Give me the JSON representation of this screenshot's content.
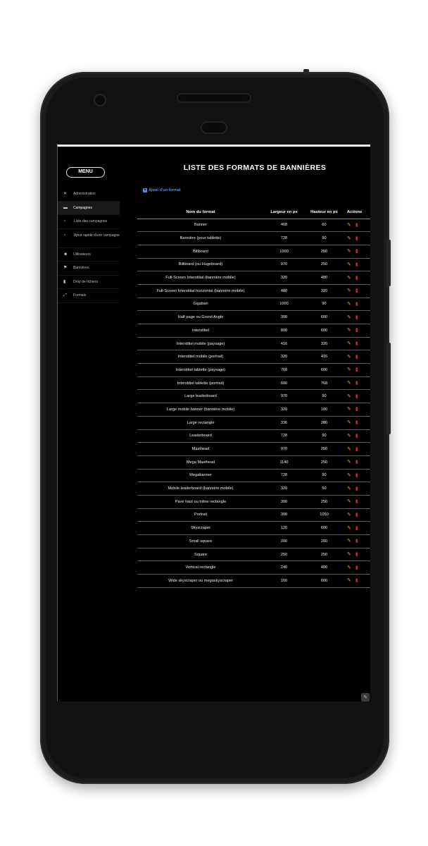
{
  "menu": {
    "label": "MENU"
  },
  "nav": [
    {
      "icon": "tools-icon",
      "glyph": "✕",
      "label": "Administration",
      "active": false,
      "sub": false
    },
    {
      "icon": "campaign-icon",
      "glyph": "▬",
      "label": "Campagnes",
      "active": true,
      "sub": false
    },
    {
      "icon": "chevron-right-icon",
      "glyph": "›",
      "label": "Liste des campagnes",
      "active": false,
      "sub": true
    },
    {
      "icon": "chevron-right-icon",
      "glyph": "›",
      "label": "Ajout rapide d'une campagne",
      "active": false,
      "sub": true
    },
    {
      "icon": "users-icon",
      "glyph": "☻",
      "label": "Utilisateurs",
      "active": false,
      "sub": false
    },
    {
      "icon": "flag-icon",
      "glyph": "⚑",
      "label": "Bannières",
      "active": false,
      "sub": false
    },
    {
      "icon": "file-icon",
      "glyph": "▮",
      "label": "Drop de fichiers",
      "active": false,
      "sub": false
    },
    {
      "icon": "resize-icon",
      "glyph": "⤢",
      "label": "Formats",
      "active": false,
      "sub": false
    }
  ],
  "page": {
    "title": "LISTE DES FORMATS DE BANNIÈRES",
    "add_label": "Ajout d'un format"
  },
  "table": {
    "headers": [
      "Nom du format",
      "Largeur en px",
      "Hauteur en px",
      "Actions"
    ],
    "rows": [
      [
        "Banner",
        "468",
        "60"
      ],
      [
        "Bannière (pour tablette)",
        "728",
        "90"
      ],
      [
        "Billboard",
        "1000",
        "250"
      ],
      [
        "Billboard (ou Hugeboard)",
        "970",
        "250"
      ],
      [
        "Full-Screen Interstitial (bannière mobile)",
        "320",
        "480"
      ],
      [
        "Full-Screen Interstitial horizontal (bannière mobile)",
        "480",
        "320"
      ],
      [
        "Gigaban",
        "1000",
        "90"
      ],
      [
        "Half-page ou Grand Angle",
        "300",
        "600"
      ],
      [
        "Interstitiel",
        "800",
        "600"
      ],
      [
        "Interstitiel mobile (paysage)",
        "416",
        "320"
      ],
      [
        "Interstitiel mobile (portrait)",
        "320",
        "416"
      ],
      [
        "Interstitiel tablette (paysage)",
        "768",
        "600"
      ],
      [
        "Interstitiel tablette (portrait)",
        "600",
        "768"
      ],
      [
        "Large leaderboard",
        "970",
        "90"
      ],
      [
        "Large mobile banner (bannière mobile)",
        "320",
        "100"
      ],
      [
        "Large rectangle",
        "336",
        "280"
      ],
      [
        "Leaderboard",
        "728",
        "90"
      ],
      [
        "Masthead",
        "970",
        "250"
      ],
      [
        "Mega Masthead",
        "1140",
        "250"
      ],
      [
        "Megabanner",
        "728",
        "90"
      ],
      [
        "Mobile leaderboard (bannière mobile)",
        "320",
        "50"
      ],
      [
        "Pavé haut ou Inline rectangle",
        "300",
        "250"
      ],
      [
        "Portrait",
        "300",
        "1050"
      ],
      [
        "Skyscraper",
        "120",
        "600"
      ],
      [
        "Small square",
        "200",
        "200"
      ],
      [
        "Square",
        "250",
        "250"
      ],
      [
        "Vertical rectangle",
        "240",
        "400"
      ],
      [
        "Wide skyscraper ou megaskyscraper",
        "160",
        "600"
      ]
    ],
    "actions": {
      "edit_icon": "edit-icon",
      "delete_icon": "trash-icon"
    }
  },
  "colors": {
    "accent_link": "#5b8fd6",
    "edit": "#e6a01e",
    "delete": "#c0302e",
    "background": "#000000"
  }
}
